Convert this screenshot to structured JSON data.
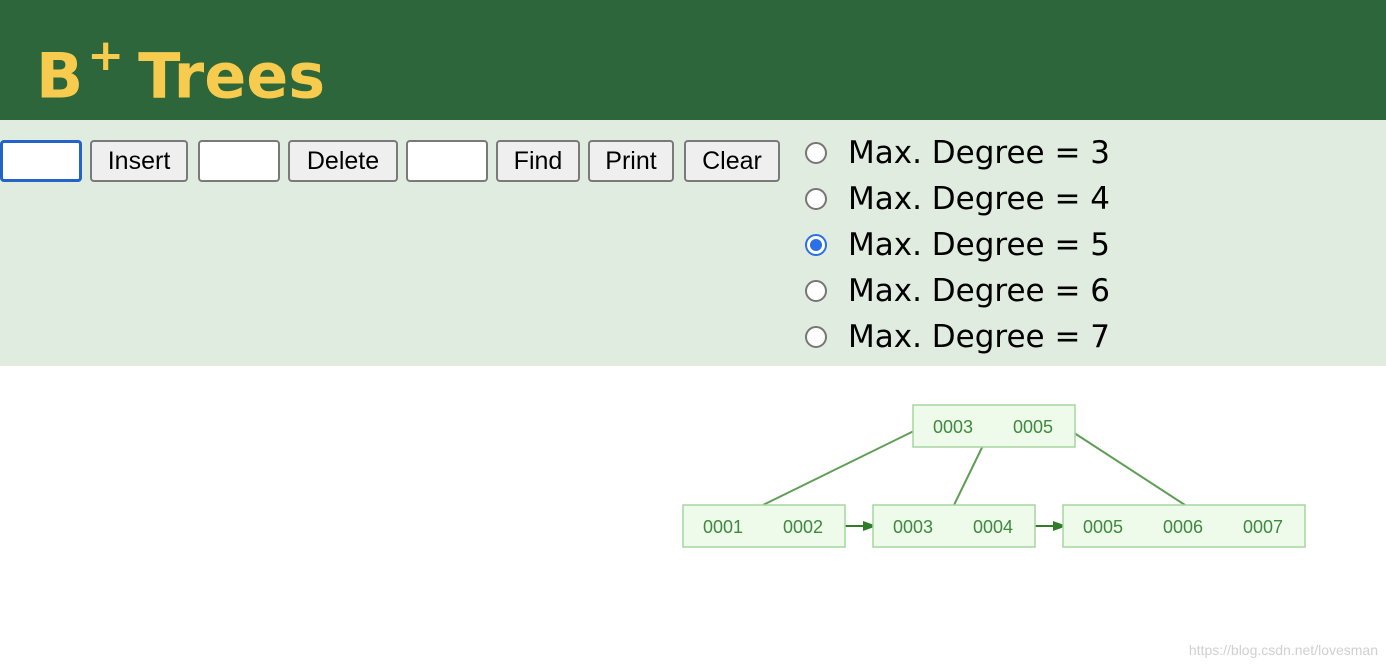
{
  "header": {
    "title": "B",
    "title_sup": "+",
    "title_rest": "Trees"
  },
  "controls": {
    "insert_value": "",
    "insert_label": "Insert",
    "delete_value": "",
    "delete_label": "Delete",
    "find_value": "",
    "find_label": "Find",
    "print_label": "Print",
    "clear_label": "Clear"
  },
  "degree_options": [
    {
      "label": "Max. Degree = 3",
      "selected": false
    },
    {
      "label": "Max. Degree = 4",
      "selected": false
    },
    {
      "label": "Max. Degree = 5",
      "selected": true
    },
    {
      "label": "Max. Degree = 6",
      "selected": false
    },
    {
      "label": "Max. Degree = 7",
      "selected": false
    }
  ],
  "tree": {
    "root": [
      "0003",
      "0005"
    ],
    "leaves": [
      [
        "0001",
        "0002"
      ],
      [
        "0003",
        "0004"
      ],
      [
        "0005",
        "0006",
        "0007"
      ]
    ],
    "colors": {
      "fill": "#eefaea",
      "stroke": "#a6d6a0",
      "text": "#3c8a3c",
      "edge": "#5f9e55",
      "arrow": "#2e7d27"
    }
  },
  "watermark": "https://blog.csdn.net/lovesman"
}
